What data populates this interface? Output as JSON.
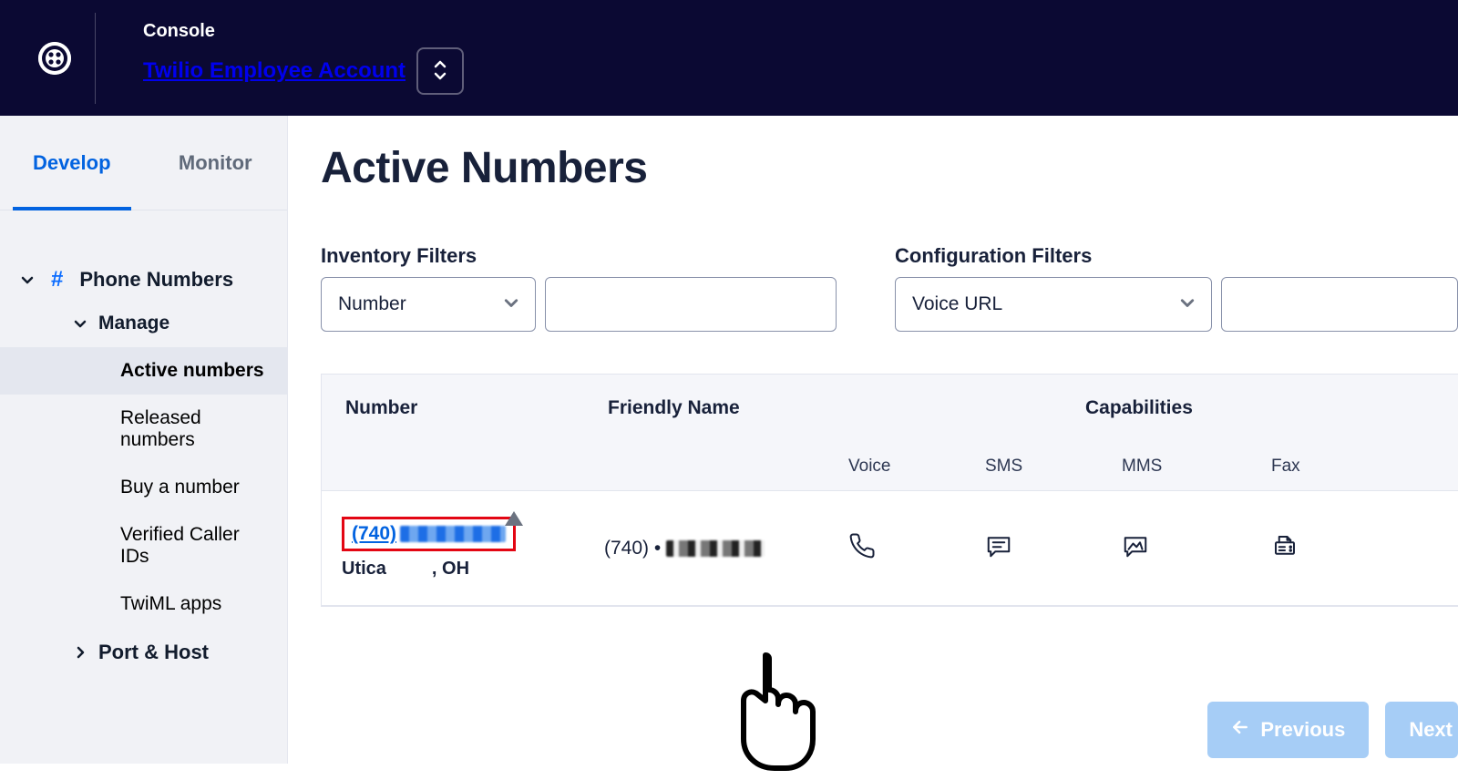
{
  "header": {
    "console_label": "Console",
    "account_name": "Twilio Employee Account"
  },
  "tabs": {
    "develop": "Develop",
    "monitor": "Monitor"
  },
  "sidebar": {
    "root": "Phone Numbers",
    "manage": "Manage",
    "items": [
      "Active numbers",
      "Released numbers",
      "Buy a number",
      "Verified Caller IDs",
      "TwiML apps"
    ],
    "port_host": "Port & Host"
  },
  "page": {
    "title": "Active Numbers",
    "inventory_label": "Inventory Filters",
    "inventory_select": "Number",
    "config_label": "Configuration Filters",
    "config_select": "Voice URL"
  },
  "table": {
    "col_number": "Number",
    "col_friendly": "Friendly Name",
    "col_capabilities": "Capabilities",
    "sub_voice": "Voice",
    "sub_sms": "SMS",
    "sub_mms": "MMS",
    "sub_fax": "Fax",
    "row": {
      "number_prefix": "(740)",
      "location_prefix": "Utica",
      "location_suffix": ", OH",
      "friendly_prefix": "(740) •"
    }
  },
  "pager": {
    "previous": "Previous",
    "next": "Next"
  }
}
